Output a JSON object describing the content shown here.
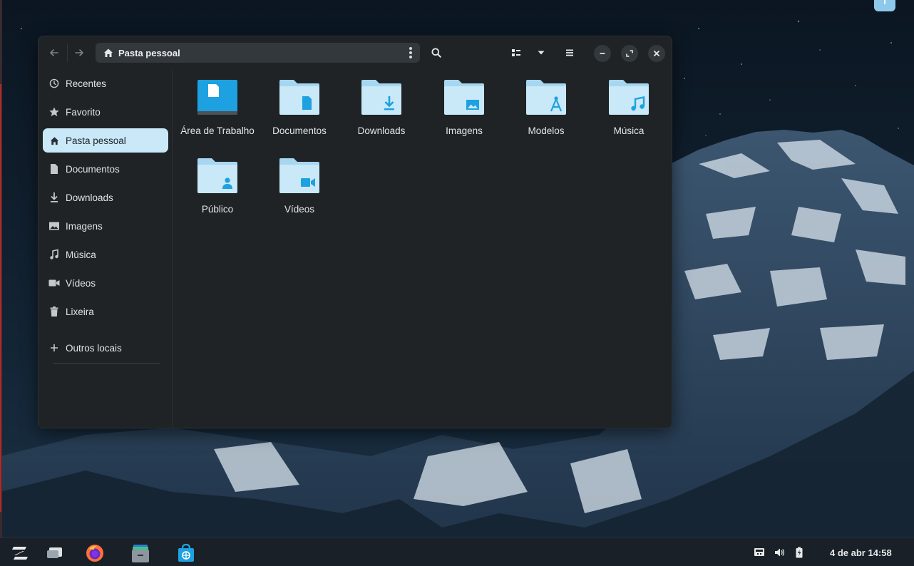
{
  "colors": {
    "accent": "#1da1e0",
    "folder_light": "#c9e8f8",
    "folder_dark": "#a7d6f1",
    "window_bg": "#1f2326",
    "sidebar_active": "#c9e8f8",
    "taskbar_bg": "#1a2027"
  },
  "header": {
    "back_icon": "arrow-left-icon",
    "forward_icon": "arrow-right-icon",
    "path_label": "Pasta pessoal",
    "search_icon": "search-icon",
    "view_icon": "grid-view-icon",
    "sort_icon": "chevron-down-icon",
    "menu_icon": "hamburger-menu-icon",
    "minimize_icon": "minimize-icon",
    "maximize_icon": "maximize-icon",
    "close_icon": "close-icon"
  },
  "sidebar": {
    "items": [
      {
        "label": "Recentes",
        "icon": "clock-icon"
      },
      {
        "label": "Favorito",
        "icon": "star-icon"
      },
      {
        "label": "Pasta pessoal",
        "icon": "home-icon",
        "active": true
      },
      {
        "label": "Documentos",
        "icon": "document-icon"
      },
      {
        "label": "Downloads",
        "icon": "download-icon"
      },
      {
        "label": "Imagens",
        "icon": "image-icon"
      },
      {
        "label": "Música",
        "icon": "music-icon"
      },
      {
        "label": "Vídeos",
        "icon": "video-icon"
      },
      {
        "label": "Lixeira",
        "icon": "trash-icon"
      }
    ],
    "other": {
      "label": "Outros locais",
      "icon": "plus-icon"
    }
  },
  "files": [
    {
      "label": "Área de Trabalho",
      "icon": "desktop-folder-icon"
    },
    {
      "label": "Documentos",
      "icon": "documents-folder-icon"
    },
    {
      "label": "Downloads",
      "icon": "downloads-folder-icon"
    },
    {
      "label": "Imagens",
      "icon": "pictures-folder-icon"
    },
    {
      "label": "Modelos",
      "icon": "templates-folder-icon"
    },
    {
      "label": "Música",
      "icon": "music-folder-icon"
    },
    {
      "label": "Público",
      "icon": "public-folder-icon"
    },
    {
      "label": "Vídeos",
      "icon": "videos-folder-icon"
    }
  ],
  "taskbar": {
    "apps": [
      {
        "name": "zorin-menu-icon"
      },
      {
        "name": "workspaces-icon"
      },
      {
        "name": "firefox-icon"
      },
      {
        "name": "files-icon"
      },
      {
        "name": "software-store-icon"
      }
    ],
    "tray": [
      "network-icon",
      "volume-icon",
      "battery-icon"
    ],
    "clock": "4 de abr  14:58"
  }
}
